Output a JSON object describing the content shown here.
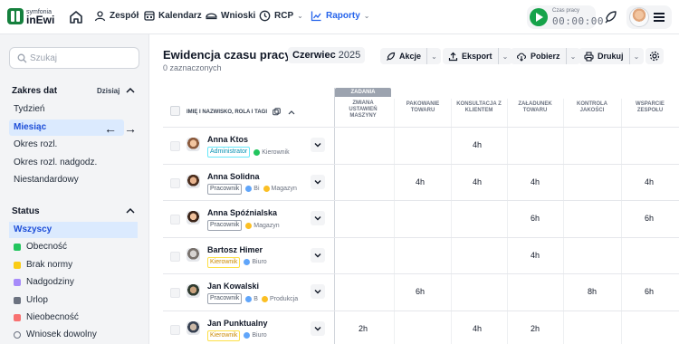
{
  "app": {
    "logo_small": "symfonia",
    "logo_big": "inEwi",
    "brand_color": "#15803d"
  },
  "nav": {
    "items": [
      {
        "label": "Zespół",
        "icon": "team-icon"
      },
      {
        "label": "Kalendarz",
        "icon": "calendar-icon"
      },
      {
        "label": "Wnioski",
        "icon": "requests-icon"
      },
      {
        "label": "RCP",
        "icon": "clock-icon",
        "has_dropdown": true
      },
      {
        "label": "Raporty",
        "icon": "chart-icon",
        "has_dropdown": true,
        "active": true
      }
    ],
    "active_color": "#2563eb"
  },
  "timer": {
    "label": "Czas pracy",
    "value": "00:00:00"
  },
  "sidebar": {
    "search_placeholder": "Szukaj",
    "date_range": {
      "title": "Zakres dat",
      "today_label": "Dzisiaj",
      "items": [
        "Tydzień",
        "Miesiąc",
        "Okres rozl.",
        "Okres rozl. nadgodz.",
        "Niestandardowy"
      ],
      "selected": "Miesiąc"
    },
    "status": {
      "title": "Status",
      "items": [
        {
          "label": "Wszyscy",
          "color": "",
          "selected": true
        },
        {
          "label": "Obecność",
          "color": "#22c55e"
        },
        {
          "label": "Brak normy",
          "color": "#facc15"
        },
        {
          "label": "Nadgodziny",
          "color": "#a78bfa"
        },
        {
          "label": "Urlop",
          "color": "#6b7280"
        },
        {
          "label": "Nieobecność",
          "color": "#f87171"
        },
        {
          "label": "Wniosek dowolny",
          "color": "",
          "outline": true
        }
      ]
    }
  },
  "header": {
    "title": "Ewidencja czasu pracy",
    "month": "Czerwiec",
    "year": "2025",
    "selected_count": "0 zaznaczonych",
    "buttons": [
      {
        "label": "Akcje",
        "icon": "actions-icon"
      },
      {
        "label": "Eksport",
        "icon": "export-icon"
      },
      {
        "label": "Pobierz",
        "icon": "download-icon"
      },
      {
        "label": "Drukuj",
        "icon": "print-icon"
      }
    ]
  },
  "table": {
    "name_header": "IMIĘ I NAZWISKO, ROLA I TAGI",
    "task_group_label": "ZADANIA",
    "columns": [
      "ZMIANA USTAWIEŃ MASZYNY",
      "PAKOWANIE TOWARU",
      "KONSULTACJA Z KLIENTEM",
      "ZAŁADUNEK TOWARU",
      "KONTROLA JAKOŚCI",
      "WSPARCIE ZESPOŁU"
    ],
    "rows": [
      {
        "name": "Anna Ktos",
        "role": "Administrator",
        "role_type": "admin",
        "groups": [
          {
            "label": "Kierownik",
            "color": "#22c55e"
          }
        ],
        "values": [
          "",
          "",
          "4h",
          "",
          "",
          ""
        ]
      },
      {
        "name": "Anna Solidna",
        "role": "Pracownik",
        "role_type": "worker",
        "groups": [
          {
            "label": "Bi",
            "color": "#60a5fa"
          },
          {
            "label": "Magazyn",
            "color": "#fbbf24"
          }
        ],
        "values": [
          "",
          "4h",
          "4h",
          "4h",
          "",
          "4h"
        ]
      },
      {
        "name": "Anna Spóźnialska",
        "role": "Pracownik",
        "role_type": "worker",
        "groups": [
          {
            "label": "Magazyn",
            "color": "#fbbf24"
          }
        ],
        "values": [
          "",
          "",
          "",
          "6h",
          "",
          "6h"
        ]
      },
      {
        "name": "Bartosz Himer",
        "role": "Kierownik",
        "role_type": "lead",
        "groups": [
          {
            "label": "Biuro",
            "color": "#60a5fa"
          }
        ],
        "values": [
          "",
          "",
          "",
          "4h",
          "",
          ""
        ]
      },
      {
        "name": "Jan Kowalski",
        "role": "Pracownik",
        "role_type": "worker",
        "groups": [
          {
            "label": "B",
            "color": "#60a5fa"
          },
          {
            "label": "Produkcja",
            "color": "#fbbf24"
          }
        ],
        "values": [
          "",
          "6h",
          "",
          "",
          "8h",
          "6h"
        ]
      },
      {
        "name": "Jan Punktualny",
        "role": "Kierownik",
        "role_type": "lead",
        "groups": [
          {
            "label": "Biuro",
            "color": "#60a5fa"
          }
        ],
        "values": [
          "2h",
          "",
          "4h",
          "2h",
          "",
          ""
        ]
      }
    ]
  }
}
